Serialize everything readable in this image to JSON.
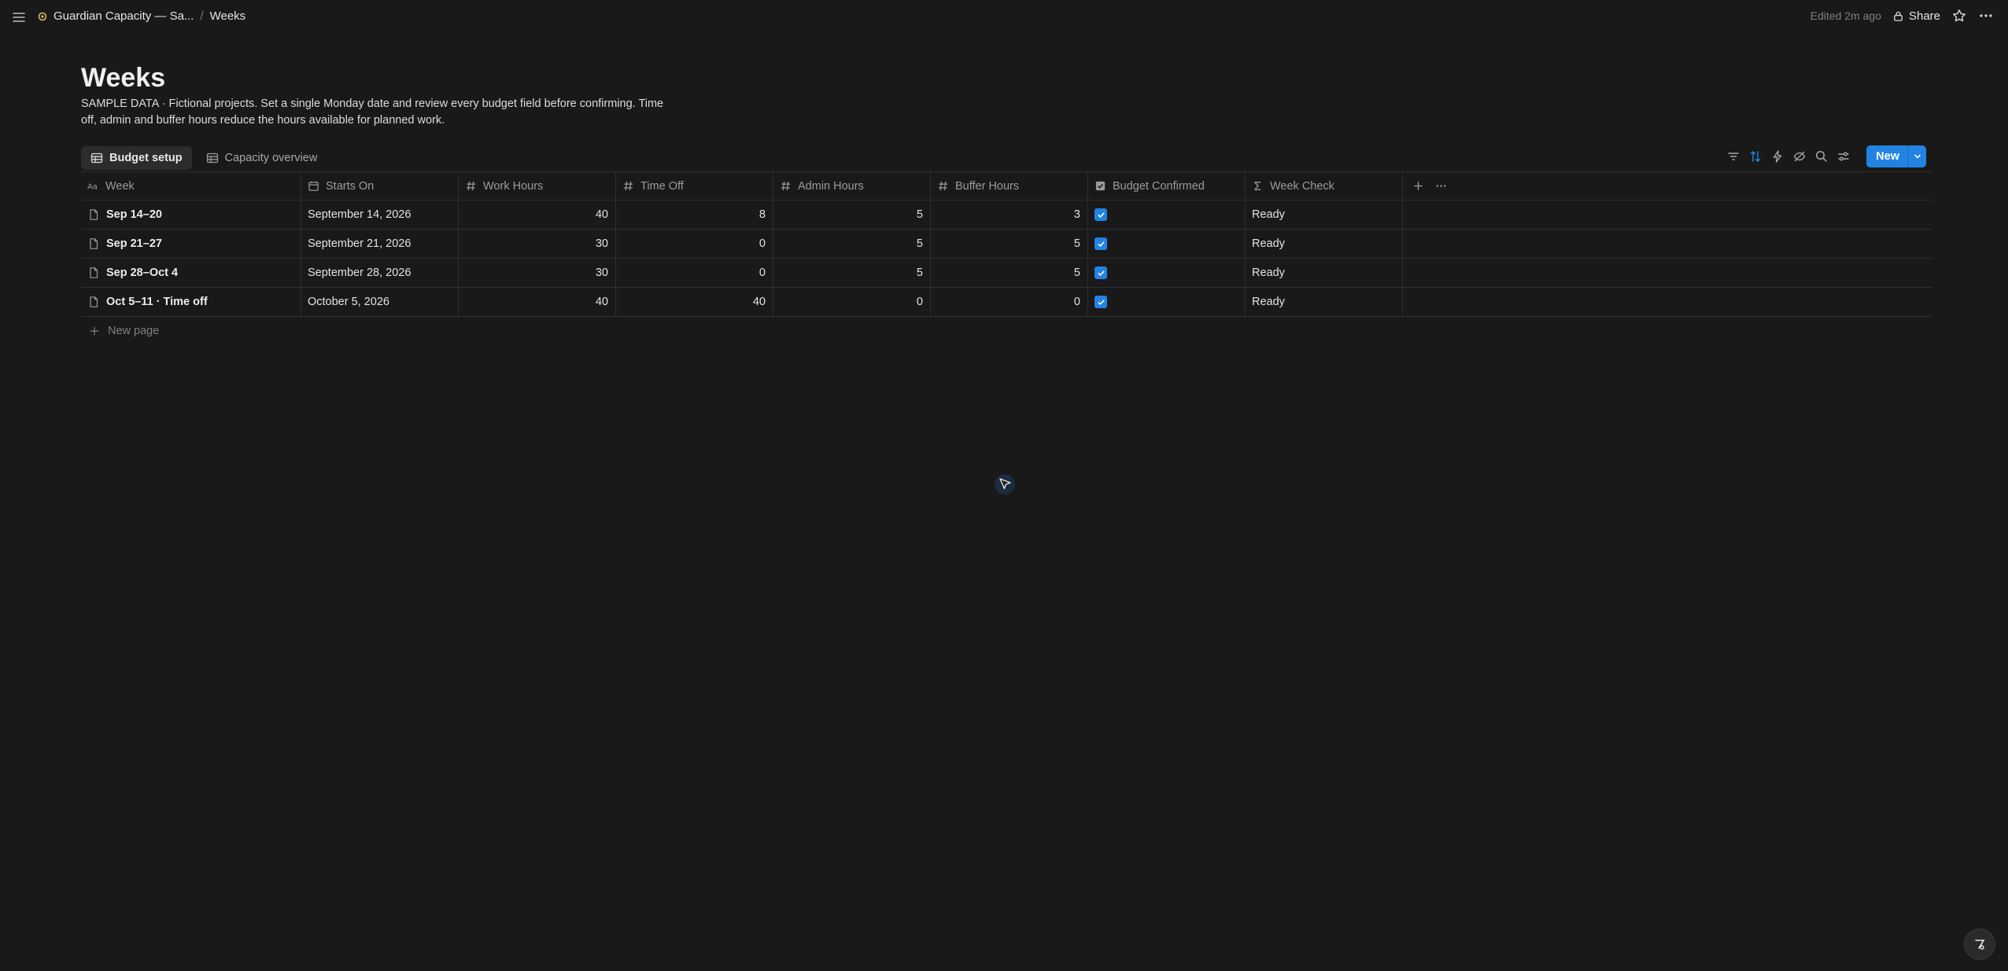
{
  "topbar": {
    "breadcrumbs": [
      "Guardian Capacity — Sa...",
      "Weeks"
    ],
    "edited": "Edited 2m ago",
    "share_label": "Share"
  },
  "page": {
    "title": "Weeks",
    "description": "SAMPLE DATA · Fictional projects. Set a single Monday date and review every budget field before confirming. Time off, admin and buffer hours reduce the hours available for planned work."
  },
  "views": [
    {
      "label": "Budget setup",
      "active": true
    },
    {
      "label": "Capacity overview",
      "active": false
    }
  ],
  "toolbar": {
    "new_label": "New",
    "accent_color": "#2383e2"
  },
  "table": {
    "columns": [
      {
        "label": "Week",
        "icon": "text-icon"
      },
      {
        "label": "Starts On",
        "icon": "calendar-icon"
      },
      {
        "label": "Work Hours",
        "icon": "number-icon"
      },
      {
        "label": "Time Off",
        "icon": "number-icon"
      },
      {
        "label": "Admin Hours",
        "icon": "number-icon"
      },
      {
        "label": "Buffer Hours",
        "icon": "number-icon"
      },
      {
        "label": "Budget Confirmed",
        "icon": "checkbox-icon"
      },
      {
        "label": "Week Check",
        "icon": "formula-icon"
      }
    ],
    "rows": [
      {
        "week": "Sep 14–20",
        "starts_on": "September 14, 2026",
        "work": "40",
        "time_off": "8",
        "admin": "5",
        "buffer": "3",
        "confirmed": true,
        "check": "Ready"
      },
      {
        "week": "Sep 21–27",
        "starts_on": "September 21, 2026",
        "work": "30",
        "time_off": "0",
        "admin": "5",
        "buffer": "5",
        "confirmed": true,
        "check": "Ready"
      },
      {
        "week": "Sep 28–Oct 4",
        "starts_on": "September 28, 2026",
        "work": "30",
        "time_off": "0",
        "admin": "5",
        "buffer": "5",
        "confirmed": true,
        "check": "Ready"
      },
      {
        "week": "Oct 5–11 · Time off",
        "starts_on": "October 5, 2026",
        "work": "40",
        "time_off": "40",
        "admin": "0",
        "buffer": "0",
        "confirmed": true,
        "check": "Ready"
      }
    ],
    "new_page_label": "New page"
  }
}
